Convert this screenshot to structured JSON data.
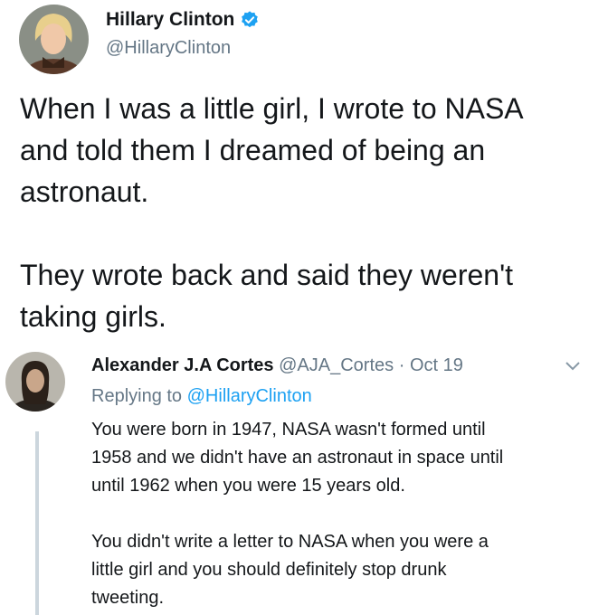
{
  "author": {
    "name": "Hillary Clinton",
    "handle": "@HillaryClinton",
    "verified_icon": "verified-badge-icon",
    "avatar_icon": "avatar-photo-icon"
  },
  "tweet": {
    "text": "When I was a little girl, I wrote to NASA\nand told them I dreamed of being an\nastronaut.\n\nThey wrote back and said they weren't\ntaking girls."
  },
  "reply": {
    "name": "Alexander J.A Cortes",
    "handle": "@AJA_Cortes",
    "separator": "·",
    "date": "Oct 19",
    "replying_prefix": "Replying to",
    "replying_handle": "@HillaryClinton",
    "text": "You were born in 1947, NASA wasn't formed until\n1958 and we didn't have an astronaut in space until\nuntil 1962 when you were 15 years old.\n\nYou didn't write a letter to NASA when you were a\nlittle girl and you should definitely stop drunk\ntweeting.",
    "menu_icon": "chevron-down-icon"
  },
  "colors": {
    "link": "#1da1f2",
    "muted": "#657786",
    "text": "#14171a",
    "thread": "#ccd6dd"
  }
}
